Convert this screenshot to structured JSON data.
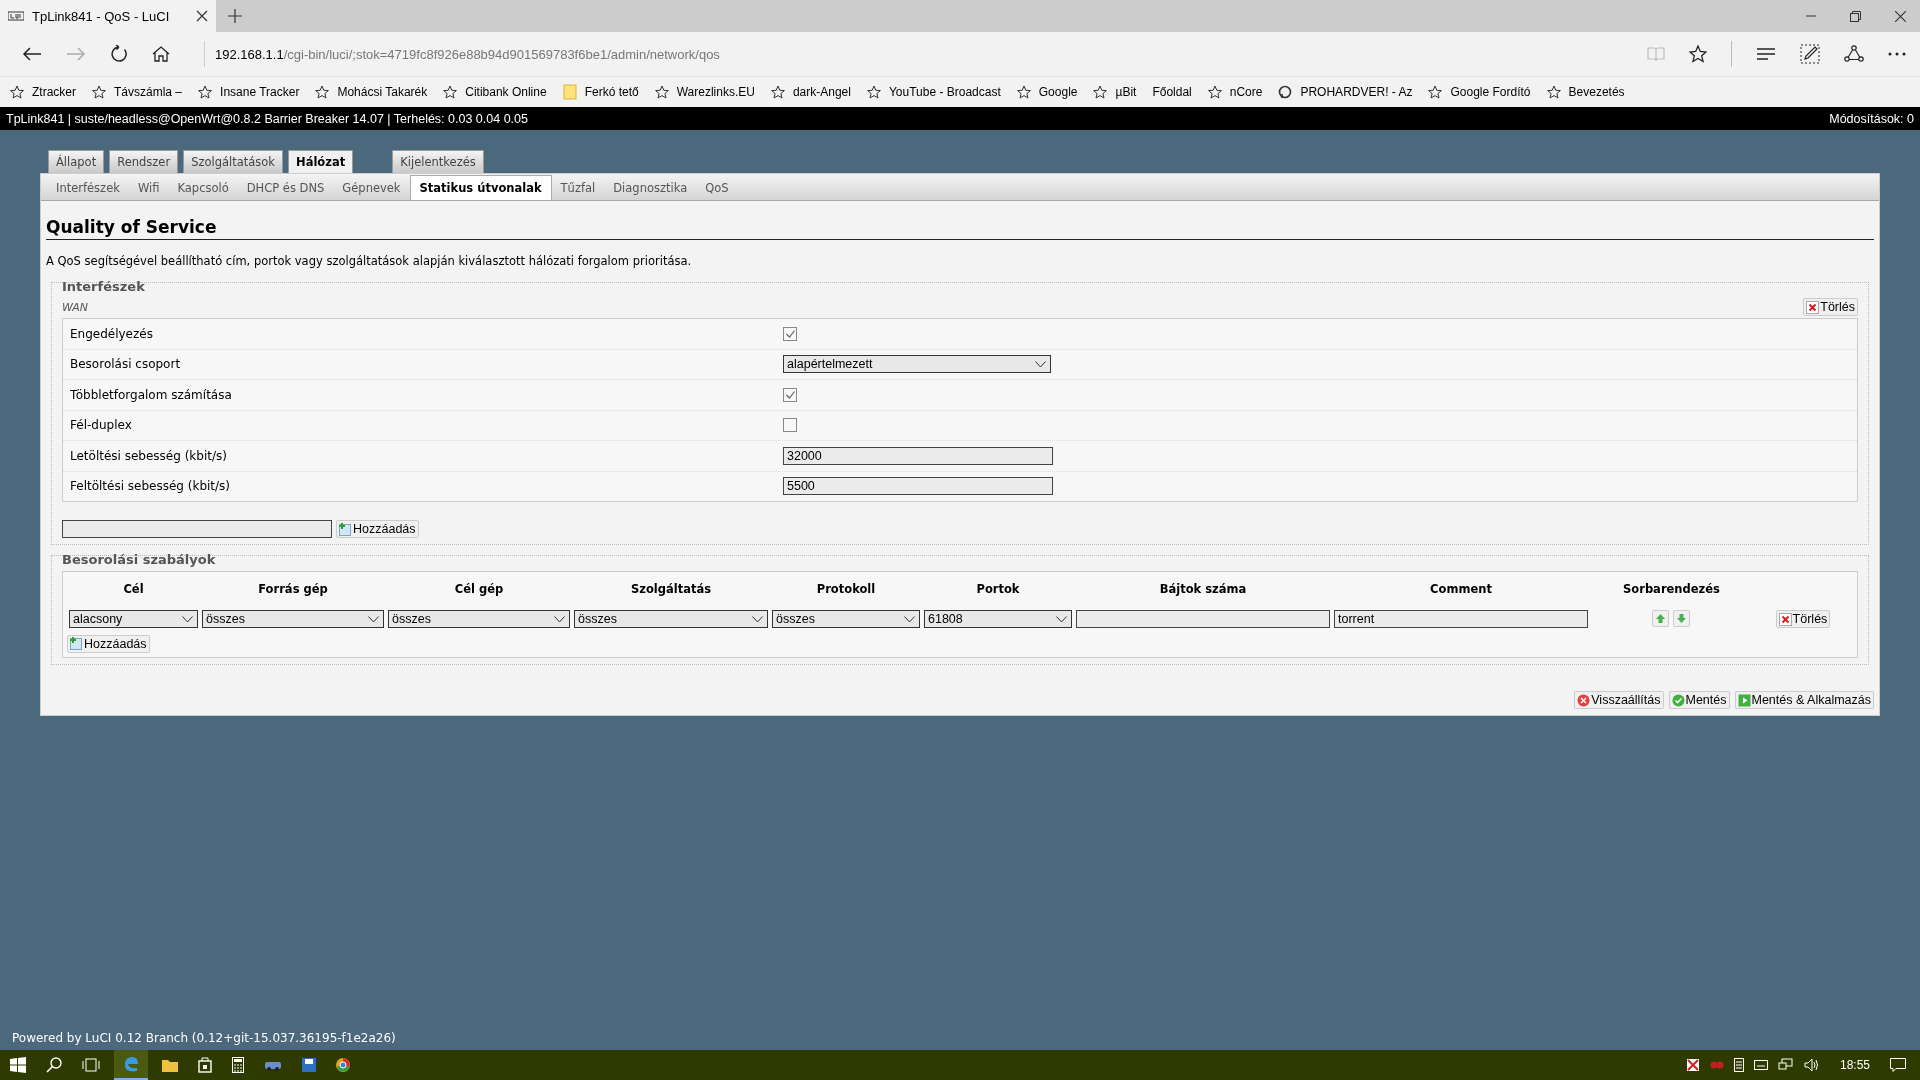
{
  "browser": {
    "tab_title": "TpLink841 - QoS - LuCI",
    "url_host": "192.168.1.1",
    "url_path": "/cgi-bin/luci/;stok=4719fc8f926e88b94d901569783f6be1/admin/network/qos",
    "bookmarks": [
      {
        "label": "Ztracker",
        "kind": "star"
      },
      {
        "label": "Távszámla –",
        "kind": "star"
      },
      {
        "label": "Insane Tracker",
        "kind": "star"
      },
      {
        "label": "Mohácsi Takarék",
        "kind": "star"
      },
      {
        "label": "Citibank Online",
        "kind": "star"
      },
      {
        "label": "Ferkó tető",
        "kind": "folder"
      },
      {
        "label": "Warezlinks.EU",
        "kind": "star"
      },
      {
        "label": "dark-Angel",
        "kind": "star"
      },
      {
        "label": "YouTube - Broadcast",
        "kind": "star"
      },
      {
        "label": "Google",
        "kind": "star"
      },
      {
        "label": "µBit",
        "kind": "star"
      },
      {
        "label": "Főoldal",
        "kind": "plain"
      },
      {
        "label": "nCore",
        "kind": "star"
      },
      {
        "label": "PROHARDVER! - Az",
        "kind": "site"
      },
      {
        "label": "Google Fordító",
        "kind": "star"
      },
      {
        "label": "Bevezetés",
        "kind": "star"
      }
    ]
  },
  "status_bar": {
    "left": "TpLink841 | suste/headless@OpenWrt@0.8.2 Barrier Breaker 14.07 | Terhelés: 0.03 0.04 0.05",
    "right": "Módosítások: 0"
  },
  "main_tabs": [
    {
      "label": "Állapot",
      "selected": false,
      "kind": "menu"
    },
    {
      "label": "Rendszer",
      "selected": false,
      "kind": "menu"
    },
    {
      "label": "Szolgáltatások",
      "selected": false,
      "kind": "menu"
    },
    {
      "label": "Hálózat",
      "selected": true,
      "kind": "menu"
    },
    {
      "label": "Kijelentkezés",
      "selected": false,
      "kind": "logout"
    }
  ],
  "sub_tabs": [
    {
      "label": "Interfészek",
      "selected": false
    },
    {
      "label": "Wifi",
      "selected": false
    },
    {
      "label": "Kapcsoló",
      "selected": false
    },
    {
      "label": "DHCP és DNS",
      "selected": false
    },
    {
      "label": "Gépnevek",
      "selected": false
    },
    {
      "label": "Statikus útvonalak",
      "selected": true
    },
    {
      "label": "Tűzfal",
      "selected": false
    },
    {
      "label": "Diagnosztika",
      "selected": false
    },
    {
      "label": "QoS",
      "selected": false
    }
  ],
  "heading": "Quality of Service",
  "description": "A QoS segítségével beállítható cím, portok vagy szolgáltatások alapján kiválasztott hálózati forgalom prioritása.",
  "interfaces": {
    "legend": "Interfészek",
    "section": "WAN",
    "delete_button": "Törlés",
    "rows": [
      {
        "kind": "checkbox",
        "label": "Engedélyezés",
        "checked": true
      },
      {
        "kind": "select",
        "label": "Besorolási csoport",
        "value": "alapértelmezett"
      },
      {
        "kind": "checkbox",
        "label": "Többletforgalom számítása",
        "checked": true
      },
      {
        "kind": "checkbox",
        "label": "Fél-duplex",
        "checked": false
      },
      {
        "kind": "text",
        "label": "Letöltési sebesség (kbit/s)",
        "value": "32000"
      },
      {
        "kind": "text",
        "label": "Feltöltési sebesség (kbit/s)",
        "value": "5500"
      }
    ],
    "add_button": "Hozzáadás"
  },
  "rules": {
    "legend": "Besorolási szabályok",
    "columns": [
      "Cél",
      "Forrás gép",
      "Cél gép",
      "Szolgáltatás",
      "Protokoll",
      "Portok",
      "Bájtok száma",
      "Comment",
      "Sorbarendezés"
    ],
    "rows": [
      {
        "cells": [
          {
            "kind": "select",
            "value": "alacsony"
          },
          {
            "kind": "select",
            "value": "összes"
          },
          {
            "kind": "select",
            "value": "összes"
          },
          {
            "kind": "select",
            "value": "összes"
          },
          {
            "kind": "select",
            "value": "összes"
          },
          {
            "kind": "select",
            "value": "61808"
          },
          {
            "kind": "text"
          },
          {
            "kind": "text",
            "value": "torrent"
          }
        ],
        "delete_button": "Törlés"
      }
    ],
    "add_button": "Hozzáadás"
  },
  "actions": [
    {
      "label": "Visszaállítás",
      "kind": "reset"
    },
    {
      "label": "Mentés",
      "kind": "save"
    },
    {
      "label": "Mentés & Alkalmazás",
      "kind": "apply"
    }
  ],
  "footer": "Powered by LuCI 0.12 Branch (0.12+git-15.037.36195-f1e2a26)",
  "taskbar": {
    "clock": "18:55"
  }
}
